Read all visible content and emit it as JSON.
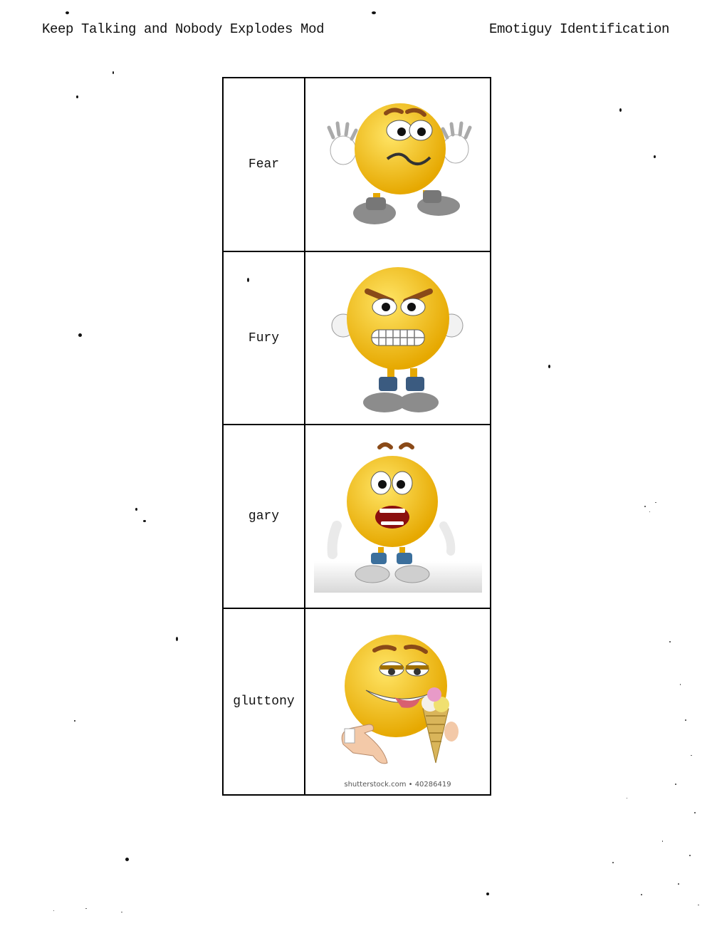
{
  "header": {
    "left": "Keep Talking and Nobody Explodes Mod",
    "right": "Emotiguy Identification"
  },
  "rows": [
    {
      "label": "Fear",
      "icon": "fear-emotiguy-icon"
    },
    {
      "label": "Fury",
      "icon": "fury-emotiguy-icon"
    },
    {
      "label": "gary",
      "icon": "gary-emotiguy-icon"
    },
    {
      "label": "gluttony",
      "icon": "gluttony-emotiguy-icon",
      "credit": "shutterstock.com • 40286419"
    }
  ],
  "colors": {
    "face": "#f6c400",
    "brow": "#8a4a18",
    "shoe": "#8c8c8c",
    "border": "#000000"
  }
}
